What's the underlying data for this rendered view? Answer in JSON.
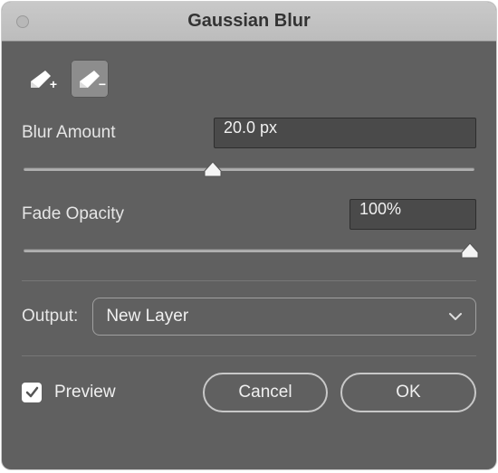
{
  "title": "Gaussian Blur",
  "blur": {
    "label": "Blur Amount",
    "value": "20.0 px",
    "slider_percent": 42
  },
  "fade": {
    "label": "Fade Opacity",
    "value": "100%",
    "slider_percent": 99
  },
  "output": {
    "label": "Output:",
    "selected": "New Layer"
  },
  "preview": {
    "label": "Preview",
    "checked": true
  },
  "buttons": {
    "cancel": "Cancel",
    "ok": "OK"
  },
  "colors": {
    "panel": "#606060",
    "input_bg": "#4a4a4a",
    "text": "#e6e6e6"
  }
}
